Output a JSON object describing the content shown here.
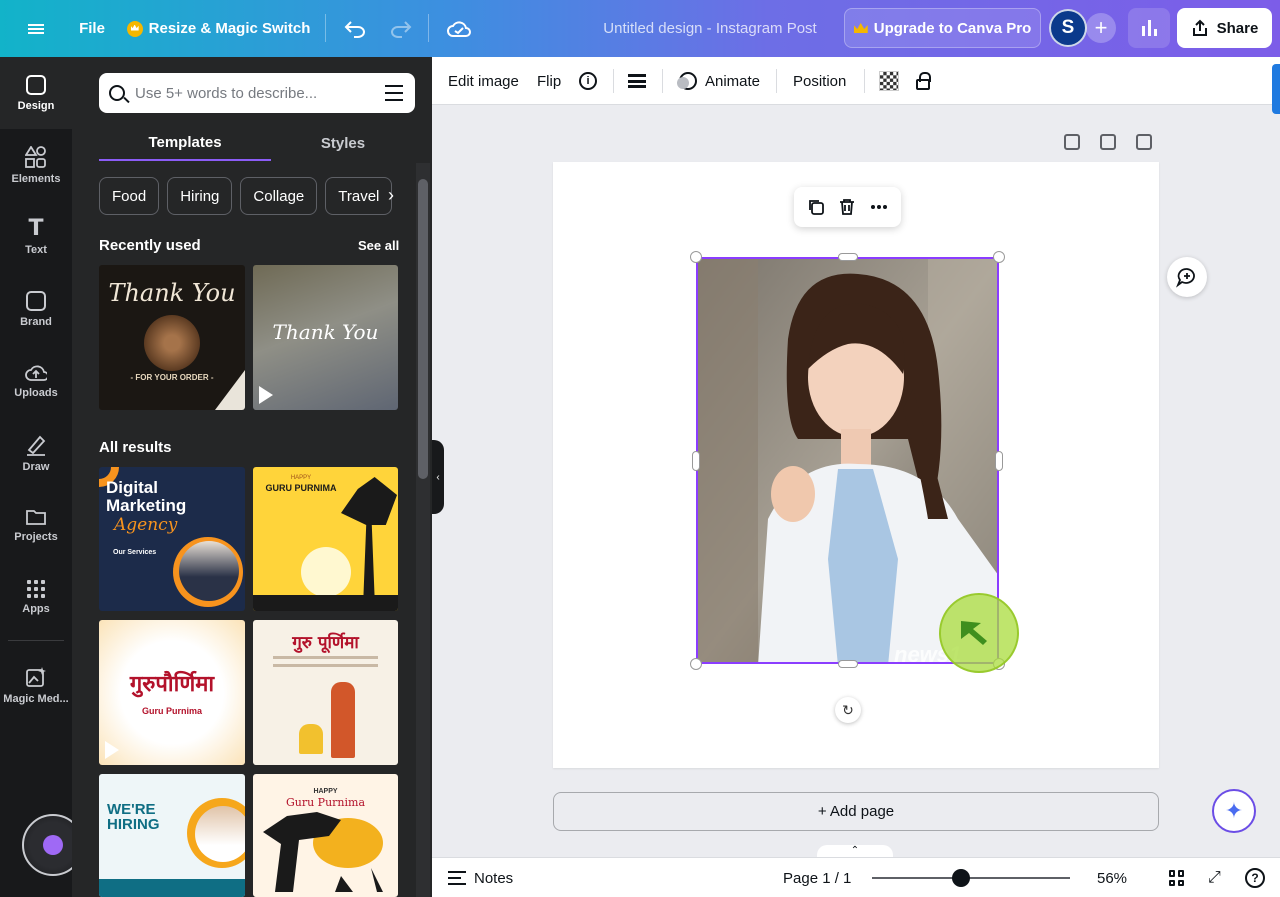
{
  "topbar": {
    "file_label": "File",
    "resize_label": "Resize & Magic Switch",
    "doc_title": "Untitled design - Instagram Post",
    "upgrade_label": "Upgrade to Canva Pro",
    "avatar_letter": "S",
    "share_label": "Share"
  },
  "leftnav": {
    "items": [
      {
        "label": "Design",
        "icon": "design-icon"
      },
      {
        "label": "Elements",
        "icon": "elements-icon"
      },
      {
        "label": "Text",
        "icon": "text-icon"
      },
      {
        "label": "Brand",
        "icon": "brand-icon"
      },
      {
        "label": "Uploads",
        "icon": "uploads-icon"
      },
      {
        "label": "Draw",
        "icon": "draw-icon"
      },
      {
        "label": "Projects",
        "icon": "projects-icon"
      },
      {
        "label": "Apps",
        "icon": "apps-icon"
      },
      {
        "label": "Magic Med...",
        "icon": "magic-media-icon"
      }
    ]
  },
  "panel": {
    "search_placeholder": "Use 5+ words to describe...",
    "tabs": [
      "Templates",
      "Styles"
    ],
    "chips": [
      "Food",
      "Hiring",
      "Collage",
      "Travel"
    ],
    "recent_title": "Recently used",
    "see_all": "See all",
    "all_results_title": "All results",
    "thumbs": {
      "thank_you_1": "Thank You",
      "thank_you_1_sub": "- FOR YOUR ORDER -",
      "thank_you_2": "Thank You",
      "digital_marketing": "Digital Marketing",
      "agency": "Agency",
      "our_services": "Our Services",
      "guru_purnima_happy": "HAPPY",
      "guru_purnima": "GURU PURNIMA",
      "guru_hindi_1": "गुरुपौर्णिमा",
      "guru_hindi_1_sub": "Guru Purnima",
      "guru_hindi_2": "गुरु पूर्णिमा",
      "were_hiring": "WE'RE HIRING",
      "happy_guru": "HAPPY",
      "guru_purnima_2": "Guru Purnima"
    }
  },
  "context_toolbar": {
    "edit_image": "Edit image",
    "flip": "Flip",
    "animate": "Animate",
    "position": "Position"
  },
  "canvas": {
    "watermark": "news1",
    "add_page": "+ Add page"
  },
  "bottombar": {
    "notes": "Notes",
    "page_indicator": "Page 1 / 1",
    "zoom_value": "56%",
    "zoom_fraction": 0.45
  },
  "colors": {
    "accent_purple": "#8b3dff",
    "topbar_start": "#12b3c9",
    "topbar_end": "#7c5de8",
    "nav_bg": "#18191b",
    "panel_bg": "#252627"
  }
}
